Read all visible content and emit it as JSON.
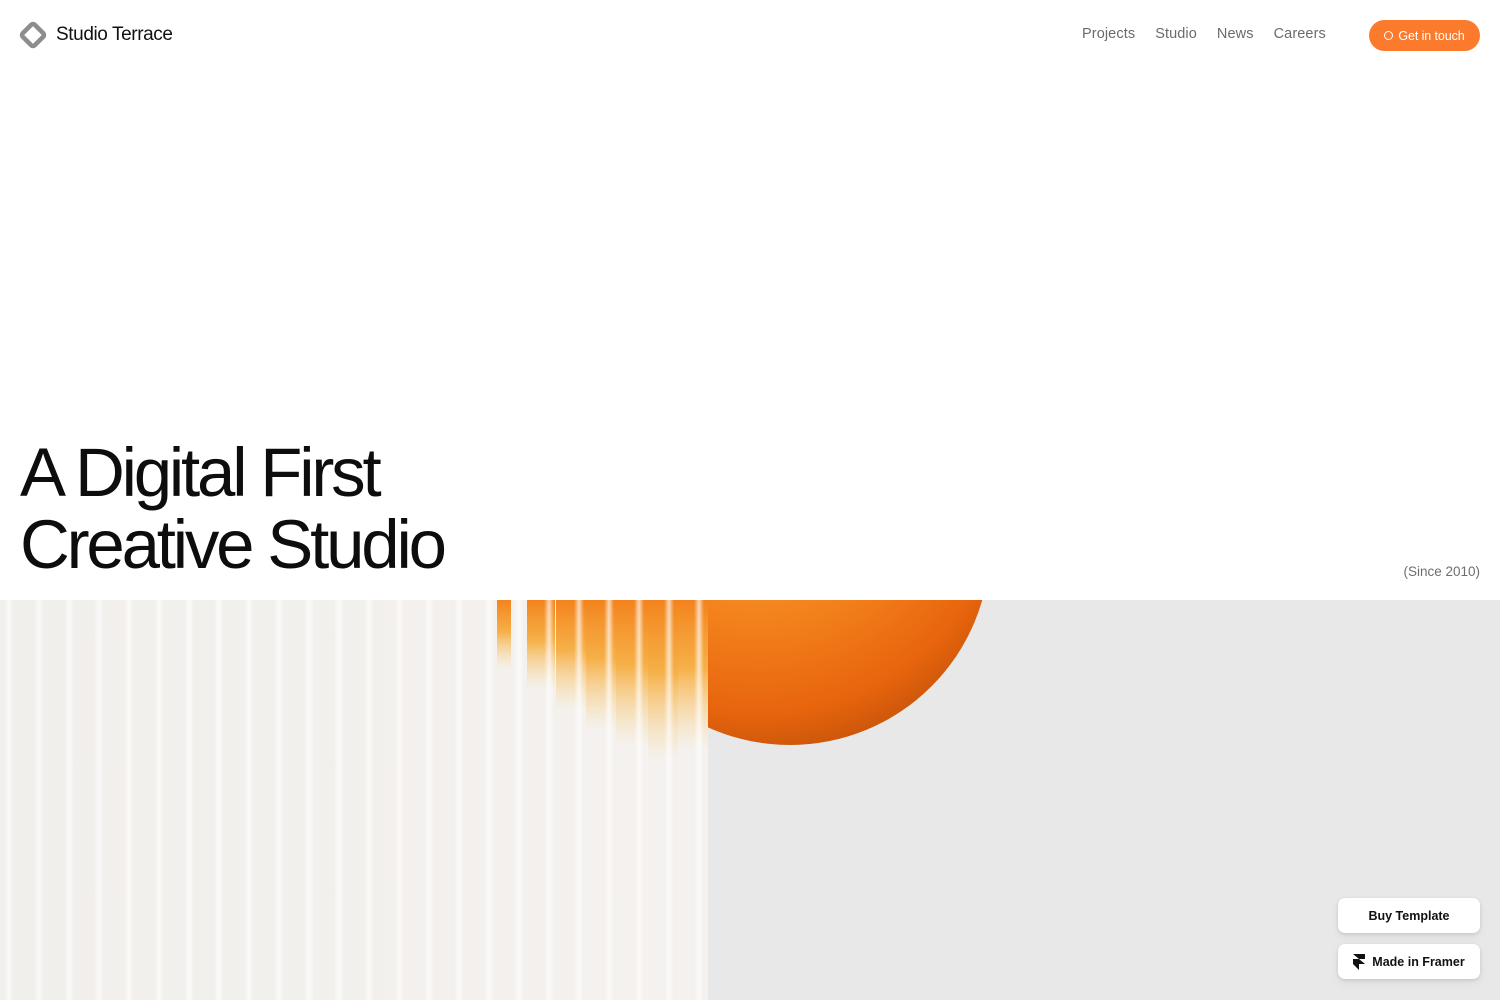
{
  "brand": {
    "name": "Studio Terrace",
    "logo_icon": "diamond-logo-icon"
  },
  "nav": {
    "items": [
      "Projects",
      "Studio",
      "News",
      "Careers"
    ]
  },
  "cta": {
    "label": "Get in touch",
    "icon": "circle-icon",
    "color": "#fb7a2c"
  },
  "hero": {
    "title_line1": "A Digital First",
    "title_line2": "Creative Studio",
    "since": "(Since 2010)",
    "image": {
      "background": "#e9e8e8",
      "accent": "#f57a1f"
    }
  },
  "floating": {
    "buy_label": "Buy Template",
    "framer_label": "Made in Framer",
    "framer_icon": "framer-logo-icon"
  }
}
